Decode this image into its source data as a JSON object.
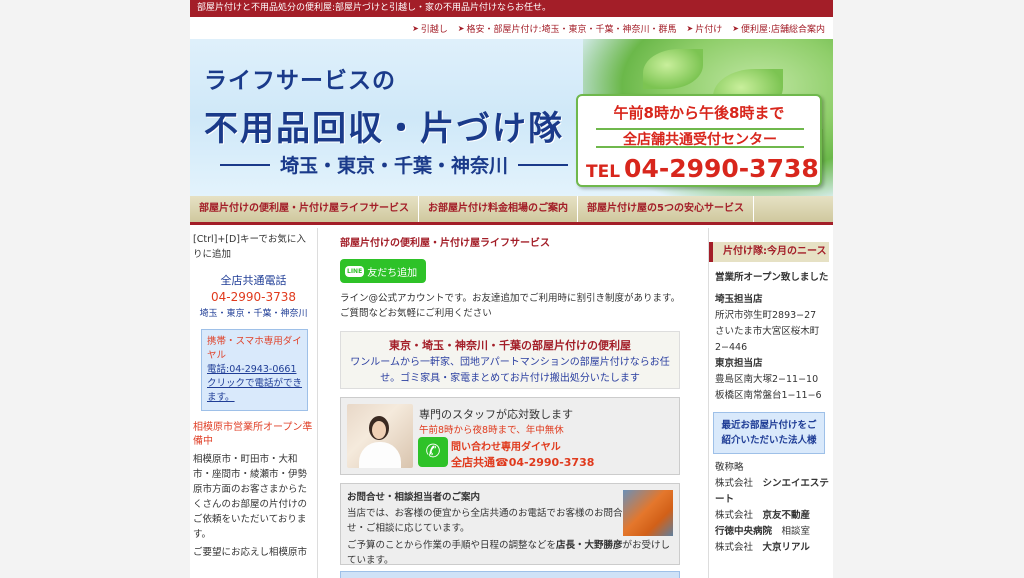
{
  "topbar": {
    "text": "部屋片付けと不用品処分の便利屋:部屋片づけと引越し・家の不用品片付けならお任せ。"
  },
  "toplinks": [
    {
      "label": "引越し"
    },
    {
      "label": "格安・部屋片付け:埼玉・東京・千葉・神奈川・群馬"
    },
    {
      "label": "片付け"
    },
    {
      "label": "便利屋:店舗総合案内"
    }
  ],
  "banner": {
    "line1": "ライフサービスの",
    "line2": "不用品回収・片づけ隊",
    "line3": "埼玉・東京・千葉・神奈川",
    "hours": "午前8時から午後8時まで",
    "center": "全店舗共通受付センター",
    "tel_label": "TEL",
    "tel_number": "04-2990-3738"
  },
  "nav": [
    {
      "label": "部屋片付けの便利屋・片付け屋ライフサービス"
    },
    {
      "label": "お部屋片付け料金相場のご案内"
    },
    {
      "label": "部屋片付け屋の5つの安心サービス"
    }
  ],
  "left": {
    "favorite": "[Ctrl]+[D]キーでお気に入りに追加",
    "tel_label": "全店共通電話",
    "tel_number": "04-2990-3738",
    "areas": "埼玉・東京・千葉・神奈川",
    "mobile_title": "携帯・スマホ専用ダイヤル",
    "mobile_link": "電話:04-2943-0661クリックで電話ができます。",
    "news_title": "相模原市営業所オープン準備中",
    "news_text": "相模原市・町田市・大和市・座間市・綾瀬市・伊勢原市方面のお客さまからたくさんのお部屋の片付けのご依頼をいただいております。",
    "news_text2": "ご要望にお応えし相模原市"
  },
  "main": {
    "title": "部屋片付けの便利屋・片付け屋ライフサービス",
    "line_button": "友だち追加",
    "line_badge": "LINE",
    "line_text": "ライン@公式アカウントです。お友達追加でご利用時に割引き制度があります。ご質問などお気軽にご利用ください",
    "box1_head": "東京・埼玉・神奈川・千葉の部屋片付けの便利屋",
    "box1_text": "ワンルームから一軒家、団地アパートマンションの部屋片付けならお任せ。ゴミ家具・家電まとめてお片付け搬出処分いたします",
    "staff_line1": "専門のスタッフが応対致します",
    "staff_line2": "午前8時から夜8時まで、年中無休",
    "staff_line3": "問い合わせ専用ダイヤル",
    "staff_line4": "全店共通☎04-2990-3738",
    "box3_head": "お問合せ・相談担当者のご案内",
    "box3_text": "当店では、お客様の便宜から全店共通のお電話でお客様のお問合せ・ご相談に応じています。",
    "box3_text2a": "ご予算のことから作業の手順や日程の調整などを",
    "box3_text2b": "店長・大野勝彦",
    "box3_text2c": "がお受けしています。"
  },
  "right": {
    "head": "片付け隊:今月のニース",
    "opened": "営業所オープン致しました",
    "saitama": "埼玉担当店",
    "addr1": "所沢市弥生町2893−27",
    "addr2": "さいたま市大宮区桜木町2−446",
    "tokyo": "東京担当店",
    "addr3": "豊島区南大塚2−11−10",
    "addr4": "板橋区南常盤台1−11−6",
    "box": "最近お部屋片付けをご紹介いただいた法人様",
    "keisho": "敬称略",
    "companies": [
      {
        "pre": "株式会社",
        "name": "シンエイエステート"
      },
      {
        "pre": "株式会社",
        "name": "京友不動産"
      },
      {
        "pre": "行徳中央病院",
        "name": "相談室"
      },
      {
        "pre": "株式会社",
        "name": "大京リアル"
      }
    ]
  }
}
